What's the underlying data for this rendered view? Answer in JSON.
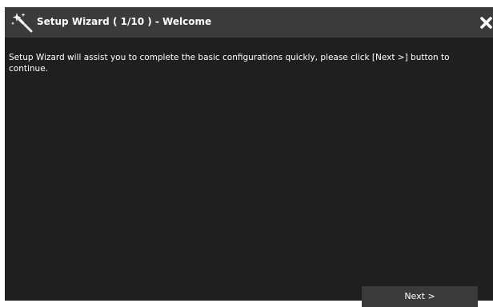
{
  "window": {
    "title": "Setup Wizard ( 1/10 ) - Welcome",
    "title_icon": "magic-wand-icon",
    "close_icon": "close-icon"
  },
  "content": {
    "message": "Setup Wizard will assist you to complete the basic configurations quickly, please click [Next >] button to continue."
  },
  "footer": {
    "next_label": "Next >"
  },
  "colors": {
    "background": "#1f1f1f",
    "titlebar": "#3b3b3b",
    "text": "#ffffff",
    "button": "#3a3a3a"
  }
}
